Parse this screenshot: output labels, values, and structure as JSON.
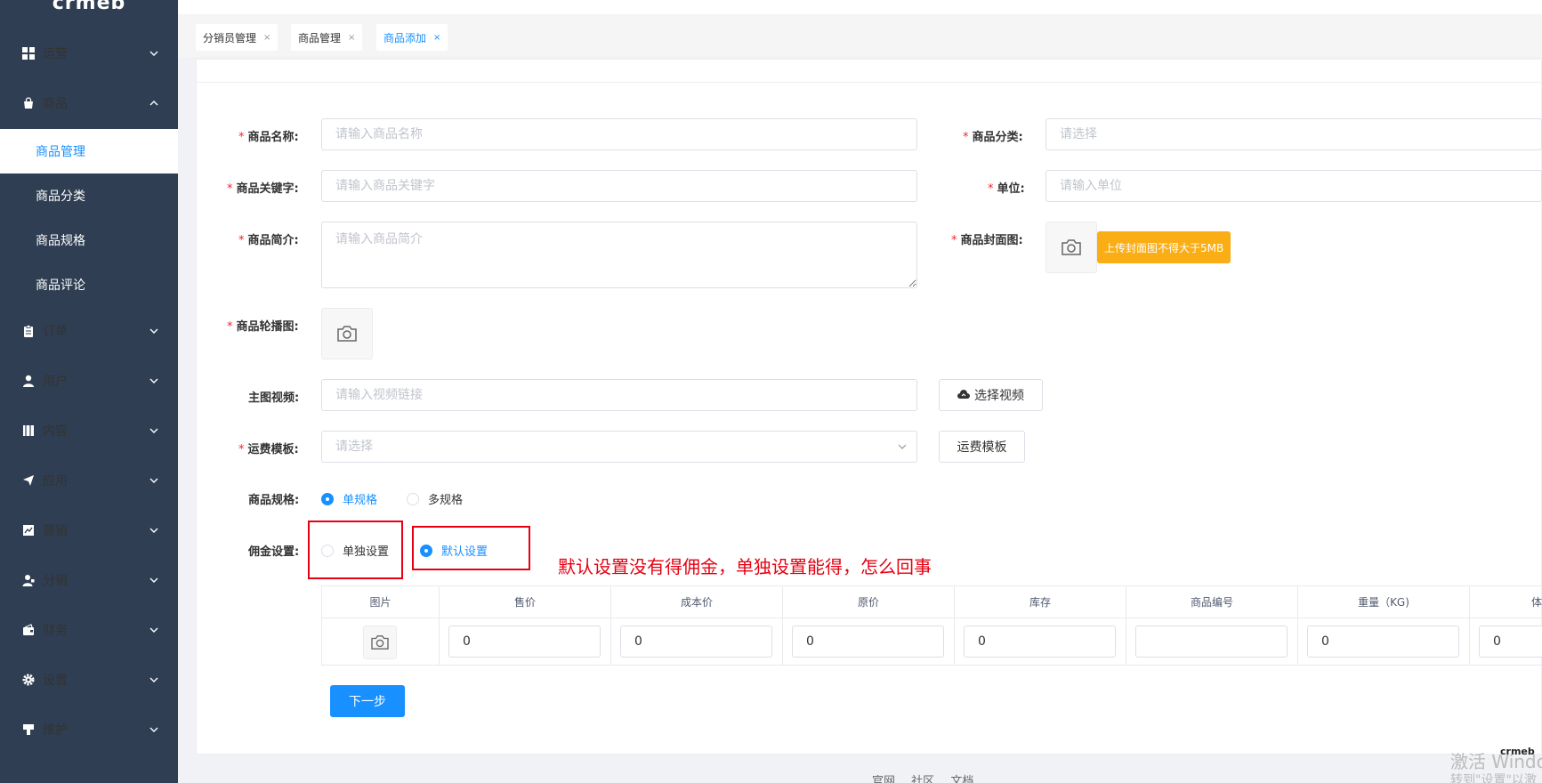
{
  "sidebar": {
    "logo": "crmeb",
    "groups": [
      {
        "label": "运营",
        "icon": "grid-icon"
      },
      {
        "label": "商品",
        "icon": "bag-icon"
      },
      {
        "label": "订单",
        "icon": "clipboard-icon"
      },
      {
        "label": "用户",
        "icon": "user-icon"
      },
      {
        "label": "内容",
        "icon": "book-icon"
      },
      {
        "label": "应用",
        "icon": "send-icon"
      },
      {
        "label": "营销",
        "icon": "chart-icon"
      },
      {
        "label": "分销",
        "icon": "distribution-icon"
      },
      {
        "label": "财务",
        "icon": "wallet-icon"
      },
      {
        "label": "设置",
        "icon": "gear-icon"
      },
      {
        "label": "维护",
        "icon": "tool-icon"
      }
    ],
    "sub_items": [
      "商品管理",
      "商品分类",
      "商品规格",
      "商品评论"
    ]
  },
  "tabs": [
    {
      "label": "分销员管理",
      "close": "×"
    },
    {
      "label": "商品管理",
      "close": "×"
    },
    {
      "label": "商品添加",
      "close": "×"
    }
  ],
  "form": {
    "name": {
      "label": "商品名称:",
      "placeholder": "请输入商品名称"
    },
    "category": {
      "label": "商品分类:",
      "placeholder": "请选择"
    },
    "keyword": {
      "label": "商品关键字:",
      "placeholder": "请输入商品关键字"
    },
    "unit": {
      "label": "单位:",
      "placeholder": "请输入单位"
    },
    "intro": {
      "label": "商品简介:",
      "placeholder": "请输入商品简介"
    },
    "cover": {
      "label": "商品封面图:",
      "tip": "上传封面图不得大于5MB"
    },
    "carousel": {
      "label": "商品轮播图:"
    },
    "video": {
      "label": "主图视频:",
      "placeholder": "请输入视频链接",
      "button": "选择视频"
    },
    "shipping": {
      "label": "运费模板:",
      "placeholder": "请选择",
      "button": "运费模板"
    },
    "spec": {
      "label": "商品规格:",
      "options": [
        "单规格",
        "多规格"
      ],
      "selected": "单规格"
    },
    "commission": {
      "label": "佣金设置:",
      "options": [
        "单独设置",
        "默认设置"
      ],
      "selected": "默认设置"
    },
    "required_mark": "*"
  },
  "annotation": "默认设置没有得佣金，单独设置能得，怎么回事",
  "table": {
    "headers": [
      "图片",
      "售价",
      "成本价",
      "原价",
      "库存",
      "商品编号",
      "重量（KG)",
      "体"
    ],
    "row": [
      "",
      "0",
      "0",
      "0",
      "0",
      "",
      "0",
      "0"
    ]
  },
  "next_button": "下一步",
  "footer": [
    "官网",
    "社区",
    "文档"
  ],
  "watermark": {
    "line1": "激活 Windo",
    "line2": "转到\"设置\"以激"
  },
  "corner_logo": "crmeb"
}
